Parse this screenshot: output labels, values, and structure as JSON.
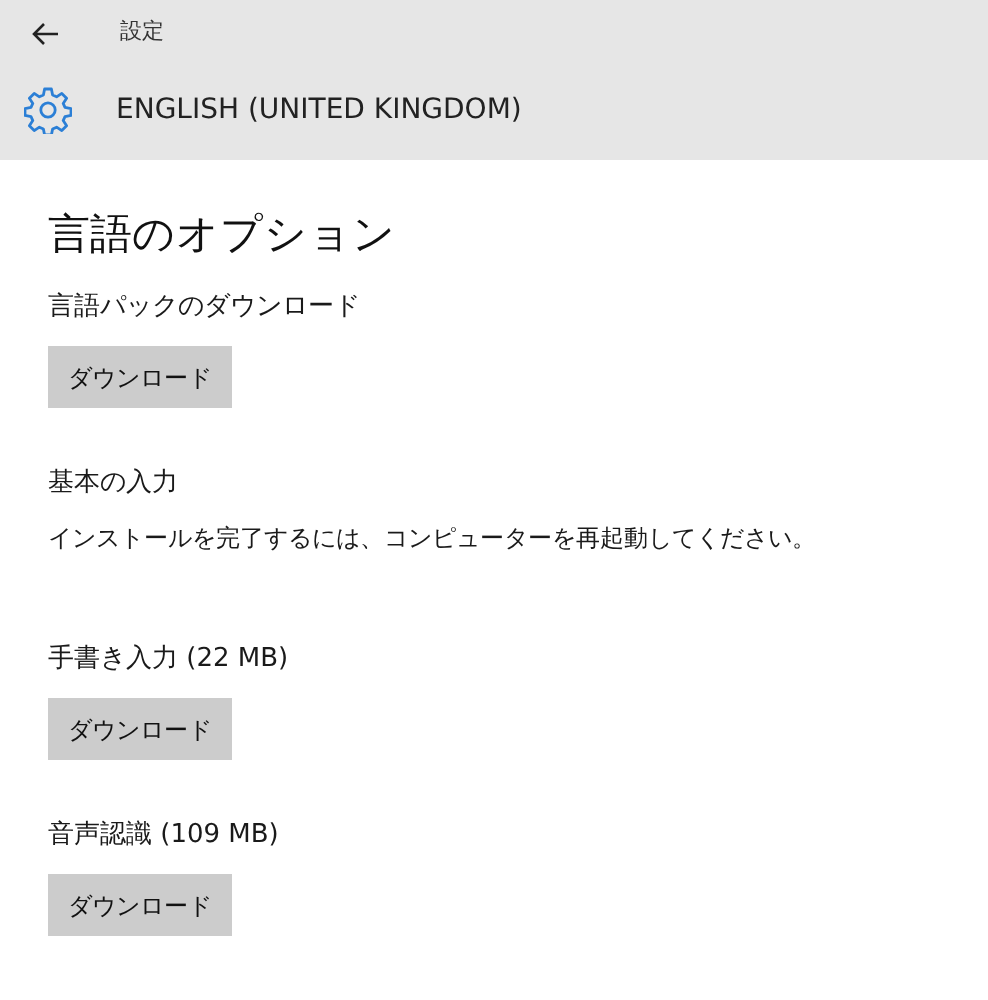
{
  "window": {
    "title": "設定"
  },
  "header": {
    "title": "ENGLISH (UNITED KINGDOM)"
  },
  "page": {
    "heading": "言語のオプション"
  },
  "sections": [
    {
      "kind": "download",
      "label": "言語パックのダウンロード",
      "button": "ダウンロード"
    },
    {
      "kind": "message",
      "label": "基本の入力",
      "message": "インストールを完了するには、コンピューターを再起動してください。"
    },
    {
      "kind": "download",
      "label": "手書き入力 (22 MB)",
      "button": "ダウンロード"
    },
    {
      "kind": "download",
      "label": "音声認識 (109 MB)",
      "button": "ダウンロード"
    }
  ]
}
